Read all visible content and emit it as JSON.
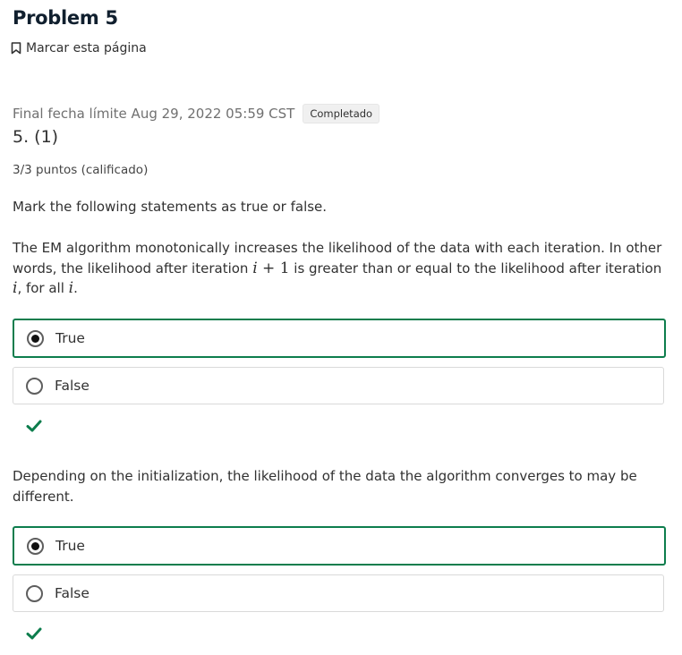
{
  "header": {
    "title": "Problem 5",
    "bookmark_label": "Marcar esta página"
  },
  "problem": {
    "deadline": "Final fecha límite Aug 29, 2022 05:59 CST",
    "status_badge": "Completado",
    "number": "5. (1)",
    "points": "3/3 puntos (calificado)",
    "instructions": "Mark the following statements as true or false."
  },
  "questions": [
    {
      "statement_part1": "The EM algorithm monotonically increases the likelihood of the data with each iteration. In other words, the likelihood after iteration ",
      "math_i": "i",
      "math_plus": " + 1",
      "statement_part2": " is greater than or equal to the likelihood after iteration ",
      "statement_part3": ", for all ",
      "statement_end": ".",
      "options": [
        "True",
        "False"
      ],
      "selected": "True",
      "result": "correct"
    },
    {
      "statement": "Depending on the initialization, the likelihood of the data the algorithm converges to may be different.",
      "options": [
        "True",
        "False"
      ],
      "selected": "True",
      "result": "correct"
    }
  ],
  "colors": {
    "accent_green": "#0d7d4d",
    "title": "#101f2e",
    "text": "#313131"
  },
  "icons": {
    "bookmark": "bookmark-icon",
    "check": "checkmark-icon"
  }
}
